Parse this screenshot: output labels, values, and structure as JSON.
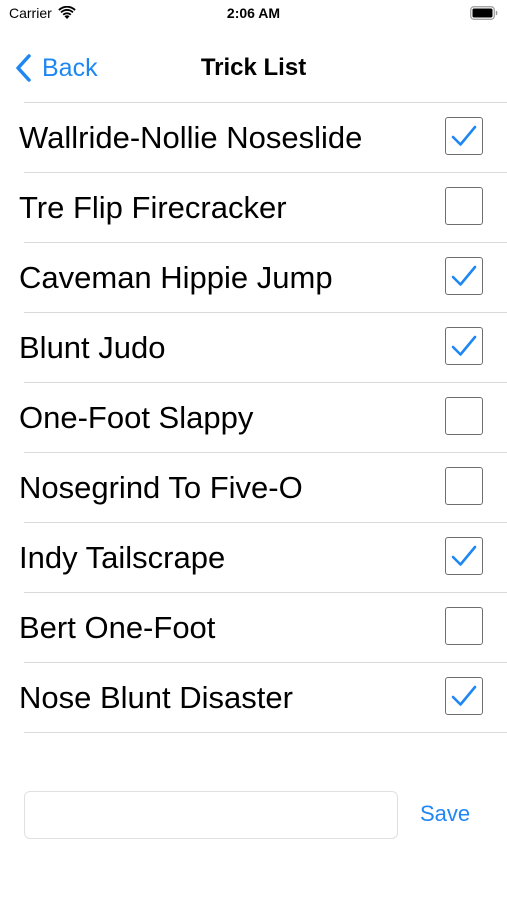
{
  "status_bar": {
    "carrier": "Carrier",
    "time": "2:06 AM"
  },
  "nav": {
    "back_label": "Back",
    "title": "Trick List"
  },
  "tricks": [
    {
      "name": "Wallride-Nollie Noseslide",
      "checked": true
    },
    {
      "name": "Tre Flip Firecracker",
      "checked": false
    },
    {
      "name": "Caveman Hippie Jump",
      "checked": true
    },
    {
      "name": "Blunt Judo",
      "checked": true
    },
    {
      "name": "One-Foot Slappy",
      "checked": false
    },
    {
      "name": "Nosegrind To Five-O",
      "checked": false
    },
    {
      "name": "Indy Tailscrape",
      "checked": true
    },
    {
      "name": "Bert One-Foot",
      "checked": false
    },
    {
      "name": "Nose Blunt Disaster",
      "checked": true
    }
  ],
  "input": {
    "value": "",
    "placeholder": ""
  },
  "save_label": "Save",
  "colors": {
    "accent": "#1f87f3",
    "divider": "#d9d9d9",
    "checkbox_border": "#6e6e6e"
  }
}
